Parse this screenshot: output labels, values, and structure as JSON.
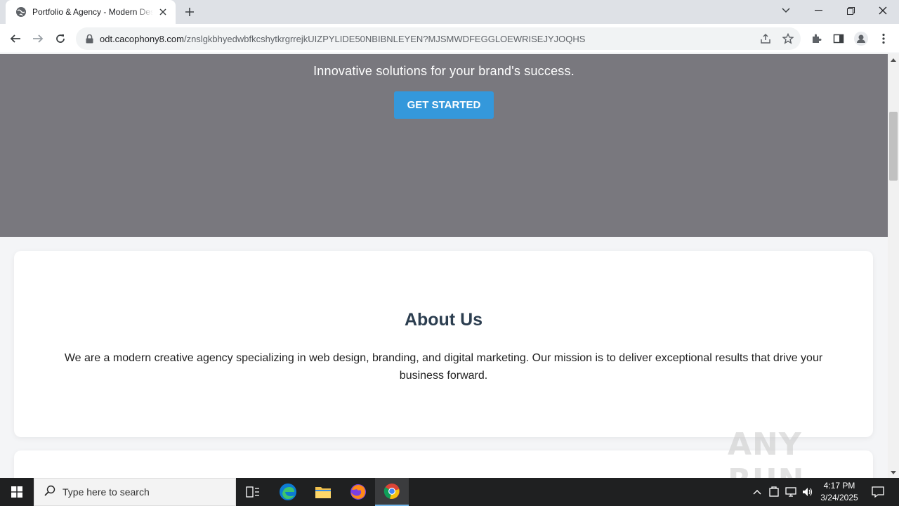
{
  "browser": {
    "tab_title": "Portfolio & Agency - Modern Design",
    "url_host": "odt.cacophony8.com",
    "url_path": "/znslgkbhyedwbfkcshytkrgrrejkUIZPYLIDE50NBIBNLEYEN?MJSMWDFEGGLOEWRISEJYJOQHS"
  },
  "hero": {
    "tagline": "Innovative solutions for your brand's success.",
    "cta_label": "GET STARTED"
  },
  "about": {
    "heading": "About Us",
    "body": "We are a modern creative agency specializing in web design, branding, and digital marketing. Our mission is to deliver exceptional results that drive your business forward."
  },
  "watermark": "ANY RUN",
  "taskbar": {
    "search_placeholder": "Type here to search",
    "time": "4:17 PM",
    "date": "3/24/2025"
  },
  "colors": {
    "hero_bg": "#79787e",
    "cta_bg": "#3498db",
    "heading": "#2c3e50"
  }
}
